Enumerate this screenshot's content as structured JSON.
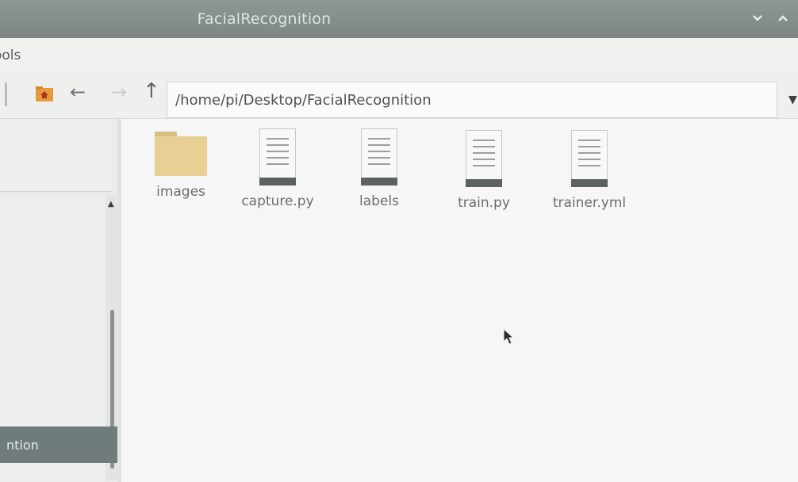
{
  "window": {
    "title": "FacialRecognition"
  },
  "menubar": {
    "items": [
      "ools"
    ]
  },
  "toolbar": {
    "path": "/home/pi/Desktop/FacialRecognition",
    "icons": [
      "home-icon",
      "back-arrow-icon",
      "forward-arrow-icon",
      "up-arrow-icon",
      "chevron-down-icon"
    ]
  },
  "sidebar": {
    "selected_label": "ntion"
  },
  "files": [
    {
      "name": "images",
      "type": "folder"
    },
    {
      "name": "capture.py",
      "type": "document"
    },
    {
      "name": "labels",
      "type": "document"
    },
    {
      "name": "train.py",
      "type": "document"
    },
    {
      "name": "trainer.yml",
      "type": "document"
    }
  ],
  "colors": {
    "titlebar": "#7d8585",
    "folder": "#e8cf94",
    "sidebar_selected": "#6f7b7c",
    "background": "#f5f6f5"
  }
}
